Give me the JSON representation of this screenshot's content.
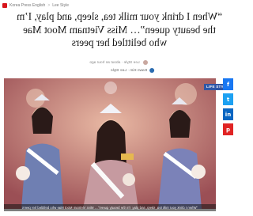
{
  "breadcrumb": {
    "items": [
      "Korea Press English",
      "Lee Style"
    ],
    "separator": ">"
  },
  "headline": "“When I drink your milk tea, sleep, and play, I’m the beauty queen”… Miss Vietnam Moot Mae who belittled her peers",
  "meta": {
    "text": "Lee Style · about an hour ago"
  },
  "byline": {
    "text": "Dawn Kim · Lee Style"
  },
  "category": "LIFE STYLE",
  "caption": "\"When I drink your milk tea, sleep, and play, I'm the beauty queen\"… Miss Vietnam Moot Mae who belittled her peers",
  "share": {
    "facebook": "f",
    "twitter": "t",
    "linkedin": "in",
    "pinterest": "p"
  },
  "colors": {
    "accent": "#d7141b",
    "badge": "#2f56a6",
    "stage": "#b66f6b"
  },
  "icons": [
    "home-icon",
    "avatar-icon",
    "facebook-icon",
    "twitter-icon",
    "linkedin-icon",
    "pinterest-icon"
  ]
}
